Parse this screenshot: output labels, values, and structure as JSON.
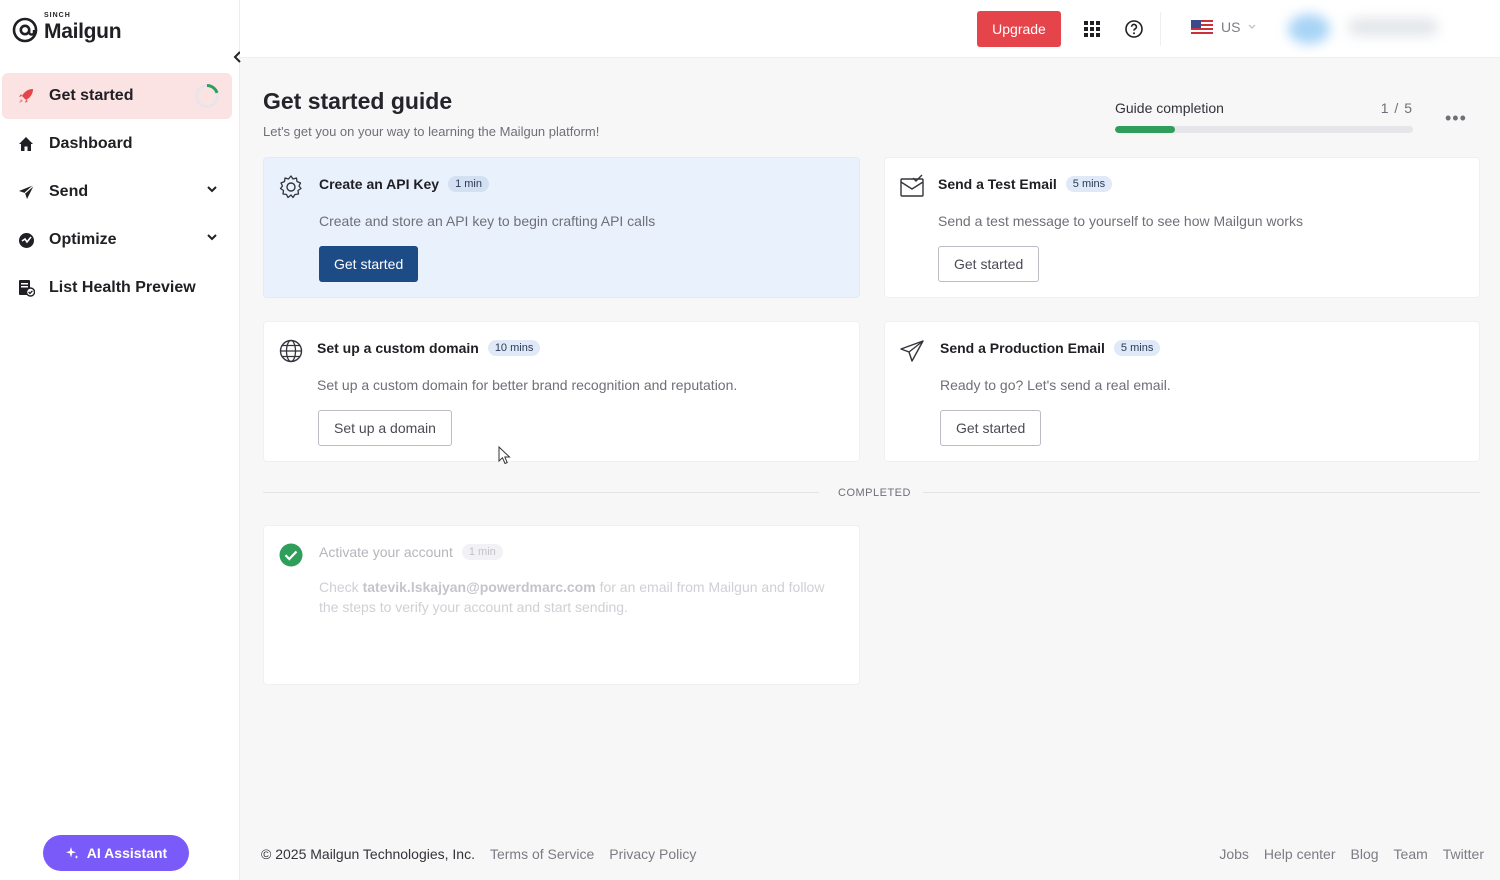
{
  "brand": {
    "small": "SINCH",
    "name": "Mailgun"
  },
  "sidebar": {
    "items": [
      {
        "label": "Get started",
        "icon": "rocket-icon",
        "active": true
      },
      {
        "label": "Dashboard",
        "icon": "home-icon"
      },
      {
        "label": "Send",
        "icon": "send-icon",
        "expandable": true
      },
      {
        "label": "Optimize",
        "icon": "optimize-icon",
        "expandable": true
      },
      {
        "label": "List Health Preview",
        "icon": "list-health-icon"
      }
    ],
    "ai_assistant": "AI Assistant"
  },
  "topbar": {
    "upgrade_label": "Upgrade",
    "region": "US"
  },
  "main": {
    "title": "Get started guide",
    "subtitle": "Let's get you on your way to learning the Mailgun platform!",
    "completion": {
      "label": "Guide completion",
      "count": "1 / 5",
      "progress": 0.2
    },
    "cards": [
      {
        "title": "Create an API Key",
        "badge": "1 min",
        "description": "Create and store an API key to begin crafting API calls",
        "button": "Get started",
        "icon": "gear-icon"
      },
      {
        "title": "Send a Test Email",
        "badge": "5 mins",
        "description": "Send a test message to yourself to see how Mailgun works",
        "button": "Get started",
        "icon": "email-check-icon"
      },
      {
        "title": "Set up a custom domain",
        "badge": "10 mins",
        "description": "Set up a custom domain for better brand recognition and reputation.",
        "button": "Set up a domain",
        "icon": "globe-icon"
      },
      {
        "title": "Send a Production Email",
        "badge": "5 mins",
        "description": "Ready to go? Let's send a real email.",
        "button": "Get started",
        "icon": "paper-plane-icon"
      }
    ],
    "completed_label": "COMPLETED",
    "completed_cards": [
      {
        "title": "Activate your account",
        "badge": "1 min",
        "description_prefix": "Check",
        "email": "tatevik.lskajyan@powerdmarc.com",
        "description_suffix": "for an email from Mailgun and follow the steps to verify your account and start sending.",
        "icon": "check-circle-icon"
      }
    ]
  },
  "footer": {
    "copyright": "© 2025 Mailgun Technologies, Inc.",
    "left_links": [
      "Terms of Service",
      "Privacy Policy"
    ],
    "right_links": [
      "Jobs",
      "Help center",
      "Blog",
      "Team",
      "Twitter"
    ]
  },
  "colors": {
    "accent": "#e5444a",
    "primary_button": "#1c4b86",
    "active_nav": "#fbe3e4",
    "progress": "#2f9e5a",
    "ai_button": "#7a5af8"
  }
}
